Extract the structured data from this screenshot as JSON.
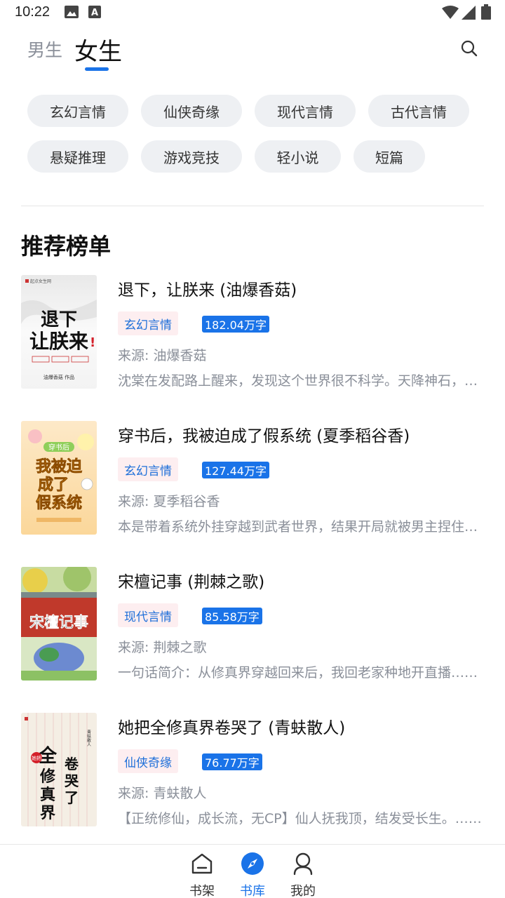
{
  "status_bar": {
    "time": "10:22",
    "icons": [
      "image-icon",
      "a-text-icon",
      "wifi-icon",
      "signal-icon",
      "battery-icon"
    ]
  },
  "header": {
    "tabs": [
      {
        "label": "男生",
        "active": false
      },
      {
        "label": "女生",
        "active": true
      }
    ],
    "search_icon": "search-icon"
  },
  "categories": [
    "玄幻言情",
    "仙侠奇缘",
    "现代言情",
    "古代言情",
    "悬疑推理",
    "游戏竞技",
    "轻小说",
    "短篇"
  ],
  "section_title": "推荐榜单",
  "books": [
    {
      "title": "退下，让朕来 (油爆香菇)",
      "genre": "玄幻言情",
      "words": "182.04万字",
      "source": "来源: 油爆香菇",
      "desc": "沈棠在发配路上醒来，发现这个世界很不科学。天降神石，九州陆沉，国将不国……",
      "cover_title": "退下让朕来",
      "cover_author": "油爆香菇 作品",
      "cover_publisher": "起点女生网"
    },
    {
      "title": "穿书后，我被迫成了假系统 (夏季稻谷香)",
      "genre": "玄幻言情",
      "words": "127.44万字",
      "source": "来源: 夏季稻谷香",
      "desc": "本是带着系统外挂穿越到武者世界，结果开局就被男主捏住……",
      "cover_title": "我被迫成了假系统",
      "cover_badge": "穿书后"
    },
    {
      "title": "宋檀记事 (荆棘之歌)",
      "genre": "现代言情",
      "words": "85.58万字",
      "source": "来源: 荆棘之歌",
      "desc": "一句话简介：从修真界穿越回来后，我回老家种地开直播……",
      "cover_title": "宋檀记事"
    },
    {
      "title": "她把全修真界卷哭了 (青蚨散人)",
      "genre": "仙侠奇缘",
      "words": "76.77万字",
      "source": "来源: 青蚨散人",
      "desc": "【正统修仙，成长流，无CP】仙人抚我顶，结发受长生。……",
      "cover_title": "全修真界卷哭了",
      "cover_small": "她把",
      "cover_author": "青蚨散人"
    }
  ],
  "bottom_nav": [
    {
      "label": "书架",
      "icon": "bookshelf-icon",
      "active": false
    },
    {
      "label": "书库",
      "icon": "compass-icon",
      "active": true
    },
    {
      "label": "我的",
      "icon": "profile-icon",
      "active": false
    }
  ],
  "colors": {
    "accent": "#1a73e8",
    "tag_bg": "#fdeef0",
    "chip_bg": "#eef0f3",
    "muted_text": "#8a8f99"
  }
}
